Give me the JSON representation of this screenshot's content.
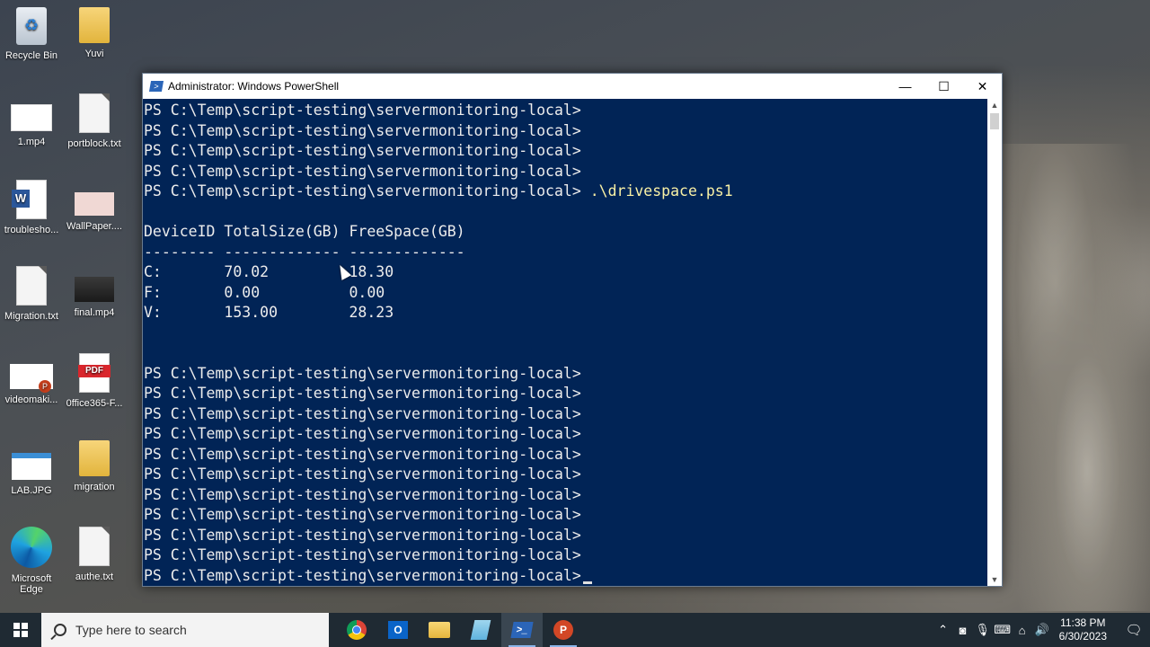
{
  "desktop": {
    "icons": [
      {
        "label": "Recycle Bin",
        "type": "recycle"
      },
      {
        "label": "Yuvi",
        "type": "folder"
      },
      {
        "label": "1.mp4",
        "type": "thumb"
      },
      {
        "label": "portblock.txt",
        "type": "doc"
      },
      {
        "label": "troublesho...",
        "type": "word"
      },
      {
        "label": "WallPaper....",
        "type": "pink"
      },
      {
        "label": "Migration.txt",
        "type": "doc"
      },
      {
        "label": "final.mp4",
        "type": "video"
      },
      {
        "label": "videomaki...",
        "type": "ppt"
      },
      {
        "label": "0ffice365-F...",
        "type": "pdf"
      },
      {
        "label": "LAB.JPG",
        "type": "lab"
      },
      {
        "label": "migration",
        "type": "folder"
      },
      {
        "label": "Microsoft\nEdge",
        "type": "edge"
      },
      {
        "label": "authe.txt",
        "type": "doc"
      }
    ]
  },
  "window": {
    "title": "Administrator: Windows PowerShell",
    "buttons": {
      "minimize": "—",
      "maximize": "☐",
      "close": "✕"
    }
  },
  "console": {
    "prompt": "PS C:\\Temp\\script-testing\\servermonitoring-local>",
    "command": ".\\drivespace.ps1",
    "leading_prompts": 4,
    "table_header": "DeviceID TotalSize(GB) FreeSpace(GB)",
    "table_rule": "-------- ------------- -------------",
    "rows": [
      {
        "id": "C:",
        "total": "70.02",
        "free": "18.30"
      },
      {
        "id": "F:",
        "total": "0.00",
        "free": "0.00"
      },
      {
        "id": "V:",
        "total": "153.00",
        "free": "28.23"
      }
    ],
    "trailing_prompts": 11
  },
  "taskbar": {
    "search_placeholder": "Type here to search",
    "apps": [
      "chrome",
      "outlook",
      "file-explorer",
      "sticky-notes",
      "powershell",
      "powerpoint"
    ],
    "active_app": "powershell",
    "time": "11:38 PM",
    "date": "6/30/2023"
  }
}
